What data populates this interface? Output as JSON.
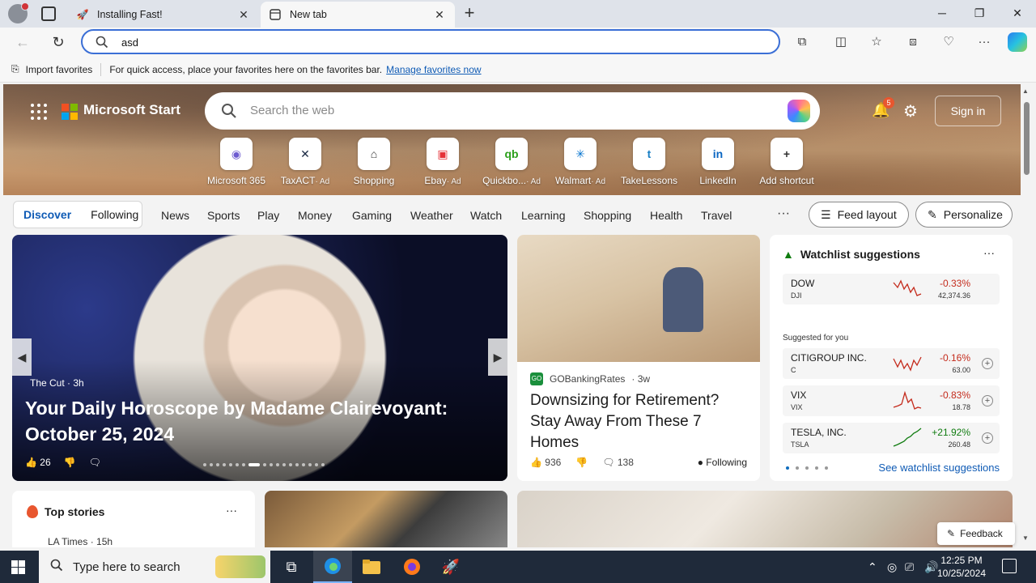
{
  "browser": {
    "tabs": [
      {
        "title": "Installing Fast!",
        "active": false
      },
      {
        "title": "New tab",
        "active": true
      }
    ],
    "address_value": "asd",
    "favorites_bar": {
      "import_label": "Import favorites",
      "hint": "For quick access, place your favorites here on the favorites bar.",
      "manage_link": "Manage favorites now"
    }
  },
  "start": {
    "brand": "Microsoft Start",
    "search_placeholder": "Search the web",
    "notification_count": "5",
    "sign_in": "Sign in",
    "shortcuts": [
      {
        "label": "Microsoft 365",
        "ad": "",
        "icon": "m365-icon",
        "glyph": "◉",
        "color": "#6d5bd0"
      },
      {
        "label": "TaxACT",
        "ad": "· Ad",
        "icon": "taxact-icon",
        "glyph": "✕",
        "color": "#1b2a44"
      },
      {
        "label": "Shopping",
        "ad": "",
        "icon": "shopping-tag-icon",
        "glyph": "⌂",
        "color": "#333333"
      },
      {
        "label": "Ebay",
        "ad": "· Ad",
        "icon": "ebay-icon",
        "glyph": "▣",
        "color": "#e53238"
      },
      {
        "label": "Quickbo...",
        "ad": "· Ad",
        "icon": "quickbooks-icon",
        "glyph": "qb",
        "color": "#2ca01c"
      },
      {
        "label": "Walmart",
        "ad": "· Ad",
        "icon": "walmart-icon",
        "glyph": "✳",
        "color": "#0071ce"
      },
      {
        "label": "TakeLessons",
        "ad": "",
        "icon": "takelessons-icon",
        "glyph": "t",
        "color": "#1a7fc4"
      },
      {
        "label": "LinkedIn",
        "ad": "",
        "icon": "linkedin-icon",
        "glyph": "in",
        "color": "#0a66c2"
      },
      {
        "label": "Add shortcut",
        "ad": "",
        "icon": "add-icon",
        "glyph": "+",
        "color": "#333333"
      }
    ],
    "nav_pills": [
      "Discover",
      "Following"
    ],
    "categories": [
      "News",
      "Sports",
      "Play",
      "Money",
      "Gaming",
      "Weather",
      "Watch",
      "Learning",
      "Shopping",
      "Health",
      "Travel"
    ],
    "feed_layout": "Feed layout",
    "personalize": "Personalize"
  },
  "hero_story": {
    "source": "The Cut · 3h",
    "title": "Your Daily Horoscope by Madame Clairevoyant: October 25, 2024",
    "likes": "26"
  },
  "story": {
    "source": "GOBankingRates",
    "age": "· 3w",
    "title": "Downsizing for Retirement? Stay Away From These 7 Homes",
    "likes": "936",
    "comments": "138",
    "following": "Following"
  },
  "watchlist": {
    "title": "Watchlist suggestions",
    "suggested_label": "Suggested for you",
    "link": "See watchlist suggestions",
    "items": [
      {
        "name": "DOW",
        "ticker": "DJI",
        "change": "-0.33%",
        "price": "42,374.36",
        "dir": "neg"
      },
      {
        "name": "CITIGROUP INC.",
        "ticker": "C",
        "change": "-0.16%",
        "price": "63.00",
        "dir": "neg"
      },
      {
        "name": "VIX",
        "ticker": "VIX",
        "change": "-0.83%",
        "price": "18.78",
        "dir": "neg"
      },
      {
        "name": "TESLA, INC.",
        "ticker": "TSLA",
        "change": "+21.92%",
        "price": "260.48",
        "dir": "pos"
      }
    ]
  },
  "top_stories": {
    "title": "Top stories",
    "source": "LA Times · 15h"
  },
  "feedback": "Feedback",
  "taskbar": {
    "search_placeholder": "Type here to search",
    "time": "12:25 PM",
    "date": "10/25/2024"
  }
}
